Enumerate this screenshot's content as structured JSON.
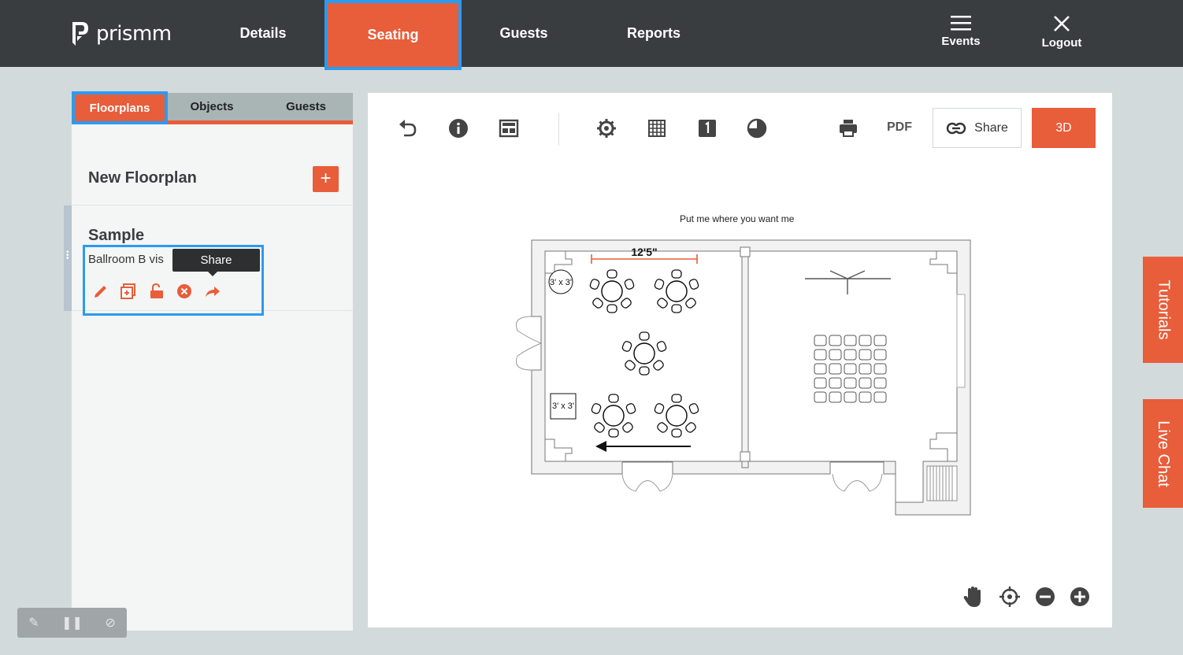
{
  "app": {
    "logo_text": "prismm"
  },
  "nav": {
    "tabs": [
      {
        "label": "Details"
      },
      {
        "label": "Seating"
      },
      {
        "label": "Guests"
      },
      {
        "label": "Reports"
      }
    ],
    "events_label": "Events",
    "logout_label": "Logout"
  },
  "sidebar": {
    "tabs": [
      {
        "label": "Floorplans"
      },
      {
        "label": "Objects"
      },
      {
        "label": "Guests"
      }
    ],
    "new_floorplan_label": "New Floorplan",
    "add_label": "+",
    "floorplan": {
      "name": "Sample",
      "description": "Ballroom B vis",
      "tooltip": "Share"
    }
  },
  "toolbar": {
    "pdf_label": "PDF",
    "share_label": "Share",
    "three_d_label": "3D",
    "icons": [
      "undo-icon",
      "info-icon",
      "layout-icon",
      "settings-icon",
      "grid-icon",
      "layer-icon",
      "contrast-icon",
      "print-icon",
      "link-icon"
    ]
  },
  "canvas": {
    "hint_text": "Put me where you want me",
    "dimension_label": "12'5\"",
    "table_label_round": "3' x 3'",
    "table_label_square": "3' x 3'"
  },
  "side_tabs": {
    "tutorials": "Tutorials",
    "live_chat": "Live Chat"
  },
  "colors": {
    "accent": "#e85d3a",
    "topbar": "#3a3d40",
    "highlight": "#2b9bf0"
  }
}
